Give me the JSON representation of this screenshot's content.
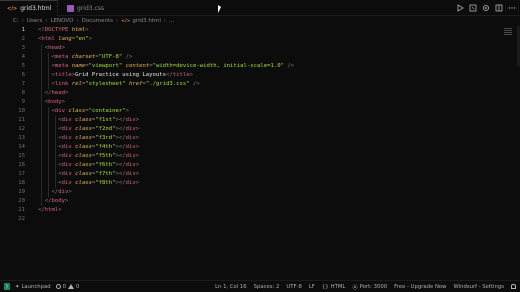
{
  "tabs": [
    {
      "label": "grid3.html",
      "icon": "html-file-icon",
      "active": true
    },
    {
      "label": "grid3.css",
      "icon": "css-file-icon",
      "active": false
    }
  ],
  "breadcrumb": [
    "C:",
    "Users",
    "LENOVO",
    "Documents",
    "grid3.html",
    "..."
  ],
  "lines": [
    {
      "n": "1",
      "tokens": [
        [
          "t-punct",
          "<"
        ],
        [
          "t-doc",
          "!DOCTYPE"
        ],
        [
          "t-text",
          " "
        ],
        [
          "t-attr",
          "html"
        ],
        [
          "t-punct",
          ">"
        ]
      ]
    },
    {
      "n": "2",
      "tokens": [
        [
          "t-punct",
          "<"
        ],
        [
          "t-tag",
          "html"
        ],
        [
          "t-text",
          " "
        ],
        [
          "t-attr",
          "lang"
        ],
        [
          "t-punct",
          "="
        ],
        [
          "t-str",
          "\"en\""
        ],
        [
          "t-punct",
          ">"
        ]
      ]
    },
    {
      "n": "3",
      "tokens": [
        [
          "t-text",
          "  "
        ],
        [
          "t-punct",
          "<"
        ],
        [
          "t-tag",
          "head"
        ],
        [
          "t-punct",
          ">"
        ]
      ]
    },
    {
      "n": "4",
      "tokens": [
        [
          "t-text",
          "    "
        ],
        [
          "t-punct",
          "<"
        ],
        [
          "t-tag",
          "meta"
        ],
        [
          "t-text",
          " "
        ],
        [
          "t-attr",
          "charset"
        ],
        [
          "t-punct",
          "="
        ],
        [
          "t-str",
          "\"UTF-8\""
        ],
        [
          "t-text",
          " "
        ],
        [
          "t-punct",
          "/>"
        ]
      ]
    },
    {
      "n": "5",
      "tokens": [
        [
          "t-text",
          "    "
        ],
        [
          "t-punct",
          "<"
        ],
        [
          "t-tag",
          "meta"
        ],
        [
          "t-text",
          " "
        ],
        [
          "t-attr",
          "name"
        ],
        [
          "t-punct",
          "="
        ],
        [
          "t-str",
          "\"viewport\""
        ],
        [
          "t-text",
          " "
        ],
        [
          "t-attr",
          "content"
        ],
        [
          "t-punct",
          "="
        ],
        [
          "t-str",
          "\"width=device-width, initial-scale=1.0\""
        ],
        [
          "t-text",
          " "
        ],
        [
          "t-punct",
          "/>"
        ]
      ]
    },
    {
      "n": "6",
      "tokens": [
        [
          "t-text",
          "    "
        ],
        [
          "t-punct",
          "<"
        ],
        [
          "t-tag",
          "title"
        ],
        [
          "t-punct",
          ">"
        ],
        [
          "t-text",
          "Grid Practice using Layouts"
        ],
        [
          "t-punct",
          "</"
        ],
        [
          "t-tag",
          "title"
        ],
        [
          "t-punct",
          ">"
        ]
      ]
    },
    {
      "n": "7",
      "tokens": [
        [
          "t-text",
          "    "
        ],
        [
          "t-punct",
          "<"
        ],
        [
          "t-tag",
          "link"
        ],
        [
          "t-text",
          " "
        ],
        [
          "t-attr",
          "rel"
        ],
        [
          "t-punct",
          "="
        ],
        [
          "t-str",
          "\"stylesheet\""
        ],
        [
          "t-text",
          " "
        ],
        [
          "t-attr",
          "href"
        ],
        [
          "t-punct",
          "="
        ],
        [
          "t-str",
          "\"./grid3.css\""
        ],
        [
          "t-text",
          " "
        ],
        [
          "t-punct",
          "/>"
        ]
      ]
    },
    {
      "n": "8",
      "tokens": [
        [
          "t-text",
          "  "
        ],
        [
          "t-punct",
          "</"
        ],
        [
          "t-tag",
          "head"
        ],
        [
          "t-punct",
          ">"
        ]
      ]
    },
    {
      "n": "9",
      "tokens": [
        [
          "t-text",
          "  "
        ],
        [
          "t-punct",
          "<"
        ],
        [
          "t-tag",
          "body"
        ],
        [
          "t-punct",
          ">"
        ]
      ]
    },
    {
      "n": "10",
      "tokens": [
        [
          "t-text",
          "    "
        ],
        [
          "t-punct",
          "<"
        ],
        [
          "t-tag",
          "div"
        ],
        [
          "t-text",
          " "
        ],
        [
          "t-attr",
          "class"
        ],
        [
          "t-punct",
          "="
        ],
        [
          "t-str",
          "\"container\""
        ],
        [
          "t-punct",
          ">"
        ]
      ]
    },
    {
      "n": "11",
      "tokens": [
        [
          "t-text",
          "      "
        ],
        [
          "t-punct",
          "<"
        ],
        [
          "t-tag",
          "div"
        ],
        [
          "t-text",
          " "
        ],
        [
          "t-attr",
          "class"
        ],
        [
          "t-punct",
          "="
        ],
        [
          "t-str",
          "\"f1st\""
        ],
        [
          "t-punct",
          "></"
        ],
        [
          "t-tag",
          "div"
        ],
        [
          "t-punct",
          ">"
        ]
      ]
    },
    {
      "n": "12",
      "tokens": [
        [
          "t-text",
          "      "
        ],
        [
          "t-punct",
          "<"
        ],
        [
          "t-tag",
          "div"
        ],
        [
          "t-text",
          " "
        ],
        [
          "t-attr",
          "class"
        ],
        [
          "t-punct",
          "="
        ],
        [
          "t-str",
          "\"f2nd\""
        ],
        [
          "t-punct",
          "></"
        ],
        [
          "t-tag",
          "div"
        ],
        [
          "t-punct",
          ">"
        ]
      ]
    },
    {
      "n": "13",
      "tokens": [
        [
          "t-text",
          "      "
        ],
        [
          "t-punct",
          "<"
        ],
        [
          "t-tag",
          "div"
        ],
        [
          "t-text",
          " "
        ],
        [
          "t-attr",
          "class"
        ],
        [
          "t-punct",
          "="
        ],
        [
          "t-str",
          "\"f3rd\""
        ],
        [
          "t-punct",
          "></"
        ],
        [
          "t-tag",
          "div"
        ],
        [
          "t-punct",
          ">"
        ]
      ]
    },
    {
      "n": "14",
      "tokens": [
        [
          "t-text",
          "      "
        ],
        [
          "t-punct",
          "<"
        ],
        [
          "t-tag",
          "div"
        ],
        [
          "t-text",
          " "
        ],
        [
          "t-attr",
          "class"
        ],
        [
          "t-punct",
          "="
        ],
        [
          "t-str",
          "\"f4th\""
        ],
        [
          "t-punct",
          "></"
        ],
        [
          "t-tag",
          "div"
        ],
        [
          "t-punct",
          ">"
        ]
      ]
    },
    {
      "n": "15",
      "tokens": [
        [
          "t-text",
          "      "
        ],
        [
          "t-punct",
          "<"
        ],
        [
          "t-tag",
          "div"
        ],
        [
          "t-text",
          " "
        ],
        [
          "t-attr",
          "class"
        ],
        [
          "t-punct",
          "="
        ],
        [
          "t-str",
          "\"f5th\""
        ],
        [
          "t-punct",
          "></"
        ],
        [
          "t-tag",
          "div"
        ],
        [
          "t-punct",
          ">"
        ]
      ]
    },
    {
      "n": "16",
      "tokens": [
        [
          "t-text",
          "      "
        ],
        [
          "t-punct",
          "<"
        ],
        [
          "t-tag",
          "div"
        ],
        [
          "t-text",
          " "
        ],
        [
          "t-attr",
          "class"
        ],
        [
          "t-punct",
          "="
        ],
        [
          "t-str",
          "\"f6th\""
        ],
        [
          "t-punct",
          "></"
        ],
        [
          "t-tag",
          "div"
        ],
        [
          "t-punct",
          ">"
        ]
      ]
    },
    {
      "n": "17",
      "tokens": [
        [
          "t-text",
          "      "
        ],
        [
          "t-punct",
          "<"
        ],
        [
          "t-tag",
          "div"
        ],
        [
          "t-text",
          " "
        ],
        [
          "t-attr",
          "class"
        ],
        [
          "t-punct",
          "="
        ],
        [
          "t-str",
          "\"f7th\""
        ],
        [
          "t-punct",
          "></"
        ],
        [
          "t-tag",
          "div"
        ],
        [
          "t-punct",
          ">"
        ]
      ]
    },
    {
      "n": "18",
      "tokens": [
        [
          "t-text",
          "      "
        ],
        [
          "t-punct",
          "<"
        ],
        [
          "t-tag",
          "div"
        ],
        [
          "t-text",
          " "
        ],
        [
          "t-attr",
          "class"
        ],
        [
          "t-punct",
          "="
        ],
        [
          "t-str",
          "\"f8th\""
        ],
        [
          "t-punct",
          "></"
        ],
        [
          "t-tag",
          "div"
        ],
        [
          "t-punct",
          ">"
        ]
      ]
    },
    {
      "n": "19",
      "tokens": [
        [
          "t-text",
          "    "
        ],
        [
          "t-punct",
          "</"
        ],
        [
          "t-tag",
          "div"
        ],
        [
          "t-punct",
          ">"
        ]
      ]
    },
    {
      "n": "20",
      "tokens": [
        [
          "t-text",
          "  "
        ],
        [
          "t-punct",
          "</"
        ],
        [
          "t-tag",
          "body"
        ],
        [
          "t-punct",
          ">"
        ]
      ]
    },
    {
      "n": "21",
      "tokens": [
        [
          "t-punct",
          "</"
        ],
        [
          "t-tag",
          "html"
        ],
        [
          "t-punct",
          ">"
        ]
      ]
    },
    {
      "n": "22",
      "tokens": []
    }
  ],
  "current_line": 1,
  "status": {
    "launchpad": "Launchpad",
    "errors": "0",
    "warnings": "0",
    "position": "Ln 1, Col 16",
    "spaces": "Spaces: 2",
    "encoding": "UTF-8",
    "eol": "LF",
    "language": "HTML",
    "port": "Port: 3000",
    "upgrade": "Free - Upgrade Now",
    "settings": "Windsurf - Settings"
  },
  "colors": {
    "background": "#0c0c0c",
    "tag": "#e0607e",
    "attribute": "#e6b450",
    "string": "#a6e22e",
    "text": "#e8e8e8",
    "punctuation": "#808080",
    "line_number": "#6e6e6e"
  }
}
